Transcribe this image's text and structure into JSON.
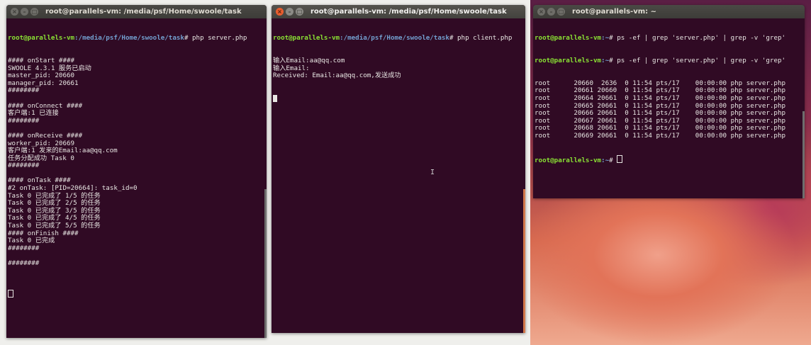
{
  "windows": {
    "server": {
      "title": "root@parallels-vm: /media/psf/Home/swoole/task",
      "prompt_user": "root@parallels-vm",
      "prompt_path": ":/media/psf/Home/swoole/task",
      "prompt_command": "# php server.php",
      "output": [
        "#### onStart ####",
        "SWOOLE 4.3.1 服务已启动",
        "master_pid: 20660",
        "manager_pid: 20661",
        "########",
        "",
        "#### onConnect ####",
        "客户端:1 已连接",
        "########",
        "",
        "#### onReceive ####",
        "worker_pid: 20669",
        "客户端:1 发来的Email:aa@qq.com",
        "任务分配成功 Task 0",
        "########",
        "",
        "#### onTask ####",
        "#2 onTask: [PID=20664]: task_id=0",
        "Task 0 已完成了 1/5 的任务",
        "Task 0 已完成了 2/5 的任务",
        "Task 0 已完成了 3/5 的任务",
        "Task 0 已完成了 4/5 的任务",
        "Task 0 已完成了 5/5 的任务",
        "#### onFinish ####",
        "Task 0 已完成",
        "########",
        "",
        "########",
        ""
      ]
    },
    "client": {
      "title": "root@parallels-vm: /media/psf/Home/swoole/task",
      "prompt_user": "root@parallels-vm",
      "prompt_path": ":/media/psf/Home/swoole/task",
      "prompt_command": "# php client.php",
      "output": [
        "输入Email:aa@qq.com",
        "输入Email:",
        "Received: Email:aa@qq.com,发送成功"
      ]
    },
    "ps": {
      "title": "root@parallels-vm: ~",
      "prompt_user": "root@parallels-vm",
      "prompt_path": ":~",
      "commands": [
        "# ps -ef | grep 'server.php' | grep -v 'grep'",
        "# ps -ef | grep 'server.php' | grep -v 'grep'"
      ],
      "rows": [
        "root      20660  2636  0 11:54 pts/17    00:00:00 php server.php",
        "root      20661 20660  0 11:54 pts/17    00:00:00 php server.php",
        "root      20664 20661  0 11:54 pts/17    00:00:00 php server.php",
        "root      20665 20661  0 11:54 pts/17    00:00:00 php server.php",
        "root      20666 20661  0 11:54 pts/17    00:00:00 php server.php",
        "root      20667 20661  0 11:54 pts/17    00:00:00 php server.php",
        "root      20668 20661  0 11:54 pts/17    00:00:00 php server.php",
        "root      20669 20661  0 11:54 pts/17    00:00:00 php server.php"
      ],
      "last_prompt": "# "
    }
  },
  "titlebar_buttons": {
    "close": "×",
    "minimize": "–",
    "maximize": "□"
  },
  "colors": {
    "terminal_bg": "#300a24",
    "prompt_user": "#8ae234",
    "prompt_path": "#729fcf",
    "close_active": "#e85e30"
  }
}
